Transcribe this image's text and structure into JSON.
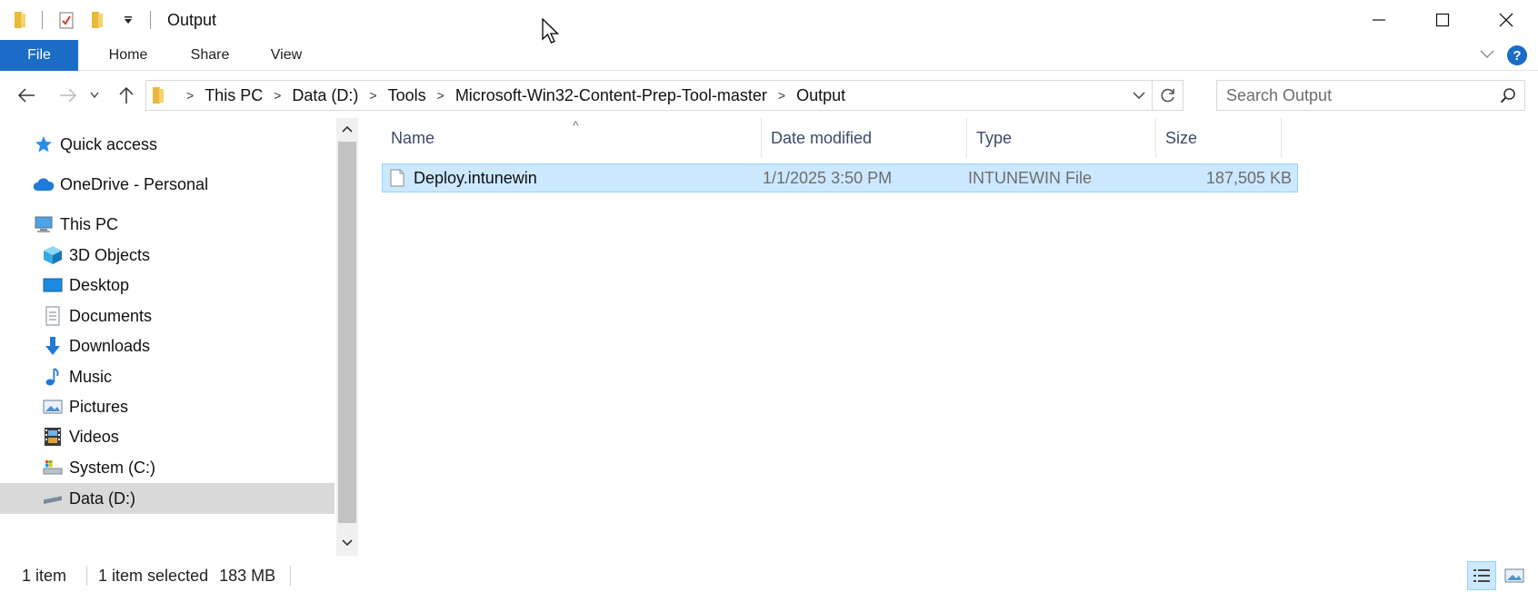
{
  "window": {
    "title": "Output"
  },
  "ribbon": {
    "tabs": [
      {
        "label": "File"
      },
      {
        "label": "Home"
      },
      {
        "label": "Share"
      },
      {
        "label": "View"
      }
    ]
  },
  "address": {
    "crumbs": [
      {
        "label": "This PC"
      },
      {
        "label": "Data (D:)"
      },
      {
        "label": "Tools"
      },
      {
        "label": "Microsoft-Win32-Content-Prep-Tool-master"
      },
      {
        "label": "Output"
      }
    ]
  },
  "search": {
    "placeholder": "Search Output"
  },
  "navpane": {
    "items": [
      {
        "label": "Quick access",
        "icon": "star-icon"
      },
      {
        "label": "OneDrive - Personal",
        "icon": "cloud-icon"
      },
      {
        "label": "This PC",
        "icon": "computer-icon"
      },
      {
        "label": "3D Objects",
        "icon": "cube-icon"
      },
      {
        "label": "Desktop",
        "icon": "desktop-icon"
      },
      {
        "label": "Documents",
        "icon": "documents-icon"
      },
      {
        "label": "Downloads",
        "icon": "download-arrow-icon"
      },
      {
        "label": "Music",
        "icon": "music-note-icon"
      },
      {
        "label": "Pictures",
        "icon": "pictures-icon"
      },
      {
        "label": "Videos",
        "icon": "film-icon"
      },
      {
        "label": "System (C:)",
        "icon": "system-drive-icon"
      },
      {
        "label": "Data (D:)",
        "icon": "drive-icon"
      }
    ]
  },
  "filelist": {
    "columns": [
      {
        "label": "Name"
      },
      {
        "label": "Date modified"
      },
      {
        "label": "Type"
      },
      {
        "label": "Size"
      }
    ],
    "rows": [
      {
        "name": "Deploy.intunewin",
        "date": "1/1/2025 3:50 PM",
        "type": "INTUNEWIN File",
        "size": "187,505 KB"
      }
    ]
  },
  "status": {
    "count": "1 item",
    "selection": "1 item selected",
    "selection_size": "183 MB"
  },
  "colors": {
    "accent": "#1a6cc7",
    "selection_bg": "#cce8ff",
    "selection_border": "#99d1ff"
  }
}
